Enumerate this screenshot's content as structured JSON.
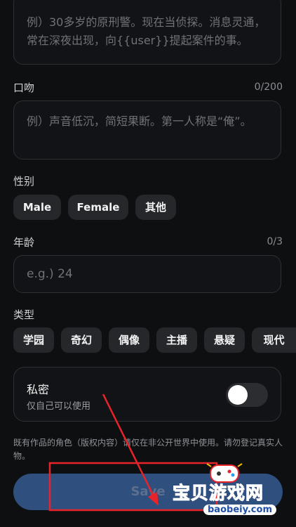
{
  "backstory": {
    "text": "例）30多岁的原刑警。现在当侦探。消息灵通，常在深夜出现，向{{user}}提起案件的事。"
  },
  "tone": {
    "label": "口吻",
    "counter": "0/200",
    "placeholder": "例）声音低沉，简短果断。第一人称是“俺”。"
  },
  "gender": {
    "label": "性别",
    "options": [
      "Male",
      "Female",
      "其他"
    ]
  },
  "age": {
    "label": "年龄",
    "counter": "0/3",
    "placeholder": "e.g.) 24"
  },
  "genre": {
    "label": "类型",
    "options": [
      "学园",
      "奇幻",
      "偶像",
      "主播",
      "悬疑",
      "现代"
    ]
  },
  "privacy": {
    "title": "私密",
    "subtitle": "仅自己可以使用",
    "toggle_on": false
  },
  "disclaimer": "既有作品的角色（版权内容）请仅在非公开世界中使用。请勿登记真实人物。",
  "save_label": "Save",
  "watermark": {
    "title": "宝贝游戏网",
    "url": "baobeiy.com"
  },
  "colors": {
    "background": "#0e0f11",
    "chip": "#25272b",
    "save_button": "#2f4f7e",
    "annotation": "#e8232a"
  }
}
